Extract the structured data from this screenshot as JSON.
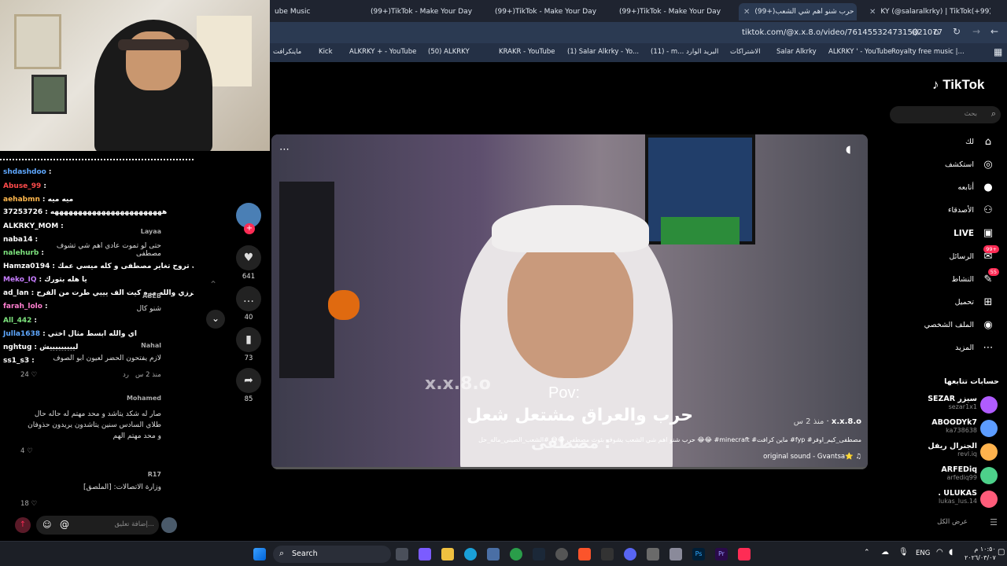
{
  "browser": {
    "tabs": [
      {
        "label": "ube Music",
        "active": false
      },
      {
        "label": "(99+)TikTok - Make Your Day",
        "active": false
      },
      {
        "label": "(99+)TikTok - Make Your Day",
        "active": false
      },
      {
        "label": "(99+)TikTok - Make Your Day",
        "active": false
      },
      {
        "label": "(99+)حرب شنو اهم شي الشعب",
        "active": true
      },
      {
        "label": "KY (@salaralkrky) | TikTok(+99)",
        "active": false
      }
    ],
    "url": "tiktok.com/@x.x.8.o/video/7614553247315021077",
    "bookmarks": [
      "Kick",
      "ALKRKY + - YouTube",
      "(50) ALKRKY",
      "KRAKR - YouTube",
      "(1) Salar Alkrky - Yo...",
      "(11) - m... البريد الوارد",
      "الاشتراكات",
      "Salar Alkrky",
      "ALKRKY ' - YouTube",
      "Royalty free music |...",
      "ماينكرافت"
    ]
  },
  "tiktok": {
    "logo": "TikTok",
    "search_placeholder": "بحث",
    "nav": [
      {
        "label": "لك",
        "icon": "home-icon"
      },
      {
        "label": "استكشف",
        "icon": "compass-icon"
      },
      {
        "label": "أتابعه",
        "icon": "following-icon"
      },
      {
        "label": "الأصدقاء",
        "icon": "friends-icon"
      },
      {
        "label": "LIVE",
        "icon": "live-icon"
      },
      {
        "label": "الرسائل",
        "icon": "messages-icon",
        "badge": "99+"
      },
      {
        "label": "النشاط",
        "icon": "activity-icon",
        "badge": "55"
      },
      {
        "label": "تحميل",
        "icon": "upload-icon"
      },
      {
        "label": "الملف الشخصي",
        "icon": "profile-icon"
      },
      {
        "label": "المزيد",
        "icon": "more-icon"
      }
    ],
    "following_title": "حسابات تتابعها",
    "following": [
      {
        "name": "SEZAR سيزر",
        "handle": "sezar1x1"
      },
      {
        "name": "ABOODYk7",
        "handle": "ka738638"
      },
      {
        "name": "الجنرال ريفل",
        "handle": "revl.iq"
      },
      {
        "name": "ARFEDiq",
        "handle": "arfediq99"
      },
      {
        "name": ". ULUKAS",
        "handle": "lukas_lus.14"
      }
    ],
    "show_all": "عرض الكل",
    "video": {
      "watermark": "x.x.8.o",
      "caption_pov": "Pov:",
      "caption_line1": "حرب والعراق مشتعل شعل",
      "caption_line2": "مصطفى :",
      "author": "x.x.8.o",
      "time": "منذ 2 س",
      "description": "حرب شنو اهم شي الشعب يشوف بثوث مصطفى 😂😅 #الشعب_الصيني_ماله_حل 😂😂 #minecraft #ماين كرافت #fyp #مصطفى_كيم_اوفر",
      "sound": "original sound - Gvantsa⭐"
    },
    "actions": {
      "likes": "641",
      "comments": "40",
      "saves": "73",
      "shares": "85"
    }
  },
  "tiktok_comments": [
    {
      "user": "Layaa",
      "text": "حتى لو تموت عادي اهم شي تشوف مصطفى"
    },
    {
      "user": "ABEB",
      "text": "شنو كال"
    },
    {
      "user": "Nahal",
      "text": "لازم يفتحون الحضر لعيون ابو الصوف"
    },
    {
      "user": "Mohamed",
      "text": "صار له شكد يتاشد و محد مهتم له حاله حال طلاي السادس سنين يتاشدون يريدون حذوفان و محد مهتم الهم"
    },
    {
      "user": "R17",
      "text": "وزارة الاتصالات: [الملصق]"
    }
  ],
  "comment_input": {
    "placeholder": "إضافة تعليق...",
    "likes_a": "24",
    "likes_b": "4",
    "likes_c": "18",
    "time": "منذ 2 س",
    "reply": "رد"
  },
  "stream_chat": [
    {
      "user": "shdashdoo",
      "msg": "",
      "color": "#5fa8ff"
    },
    {
      "user": "Abuse_99",
      "msg": "",
      "color": "#ff4b4b"
    },
    {
      "user": "aehabmn",
      "msg": "ميه ميه",
      "color": "#ffb84d"
    },
    {
      "user": "37253726",
      "msg": "ههههههههههههههههههههههههه",
      "color": "#ffffff"
    },
    {
      "user": "ALKRKY_MOM",
      "msg": "",
      "color": "#ffffff"
    },
    {
      "user": "naba14",
      "msg": "",
      "color": "#ffffff"
    },
    {
      "user": "nalehurb",
      "msg": "",
      "color": "#7de37d"
    },
    {
      "user": "Hamza0194",
      "msg": "احجاك تروح تغاير مصطفى و كله ميسي عمك",
      "color": "#ffffff"
    },
    {
      "user": "Meko_IQ",
      "msg": "يا هله بتورك",
      "color": "#c77dff"
    },
    {
      "user": "ad_lan",
      "msg": "الكرزي والله مره كيت الف يييي طرت من الفرح",
      "color": "#ffffff"
    },
    {
      "user": "farah_lolo",
      "msg": "",
      "color": "#ff7fd0"
    },
    {
      "user": "All_442",
      "msg": "",
      "color": "#7de37d"
    },
    {
      "user": "Julla1638",
      "msg": "اي والله ابسط مثال اختي",
      "color": "#5fa8ff"
    },
    {
      "user": "nghtug",
      "msg": "ليييييييييش",
      "color": "#ffffff"
    },
    {
      "user": "ss1_s3",
      "msg": "",
      "color": "#ffffff"
    }
  ],
  "taskbar": {
    "search": "Search",
    "lang": "ENG",
    "time": "١٠:٥٠ م",
    "date": "٢٠٢٦/٠٣/٠٧"
  }
}
